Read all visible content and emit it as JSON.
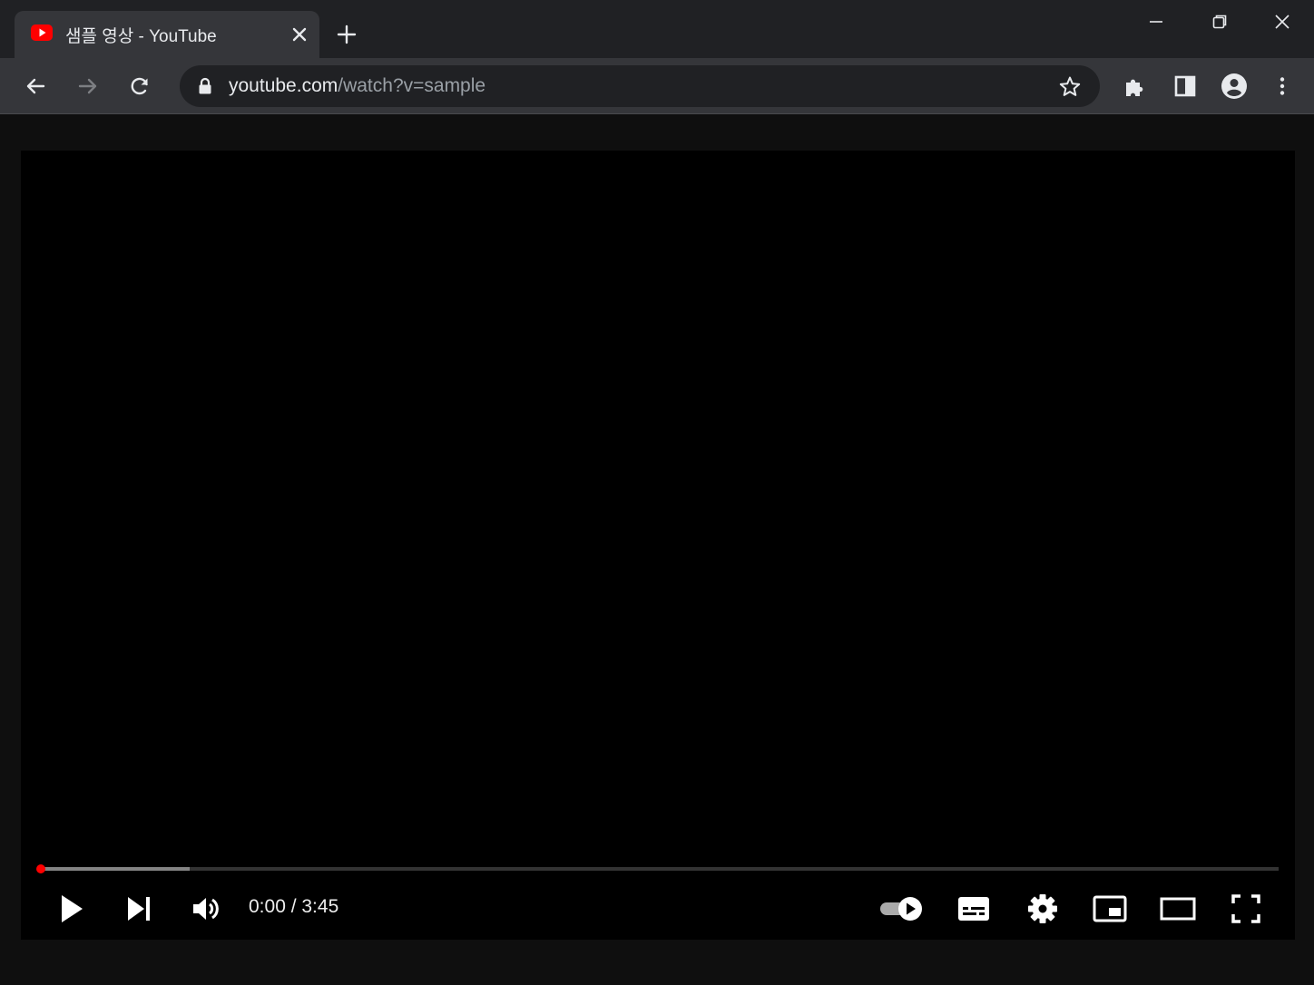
{
  "tab": {
    "title": "샘플 영상 - YouTube",
    "favicon_icon": "youtube-icon"
  },
  "omnibox": {
    "url_host": "youtube.com",
    "url_path": "/watch?v=sample"
  },
  "player": {
    "time_display": "0:00 / 3:45",
    "progress_played_fraction": 0.0,
    "progress_loaded_fraction": 0.12,
    "autoplay_on": true
  },
  "colors": {
    "accent": "#ff0000",
    "tabstrip": "#202124",
    "toolbar": "#35363a",
    "page_bg": "#0f0f0f",
    "icon": "#e8eaed"
  }
}
